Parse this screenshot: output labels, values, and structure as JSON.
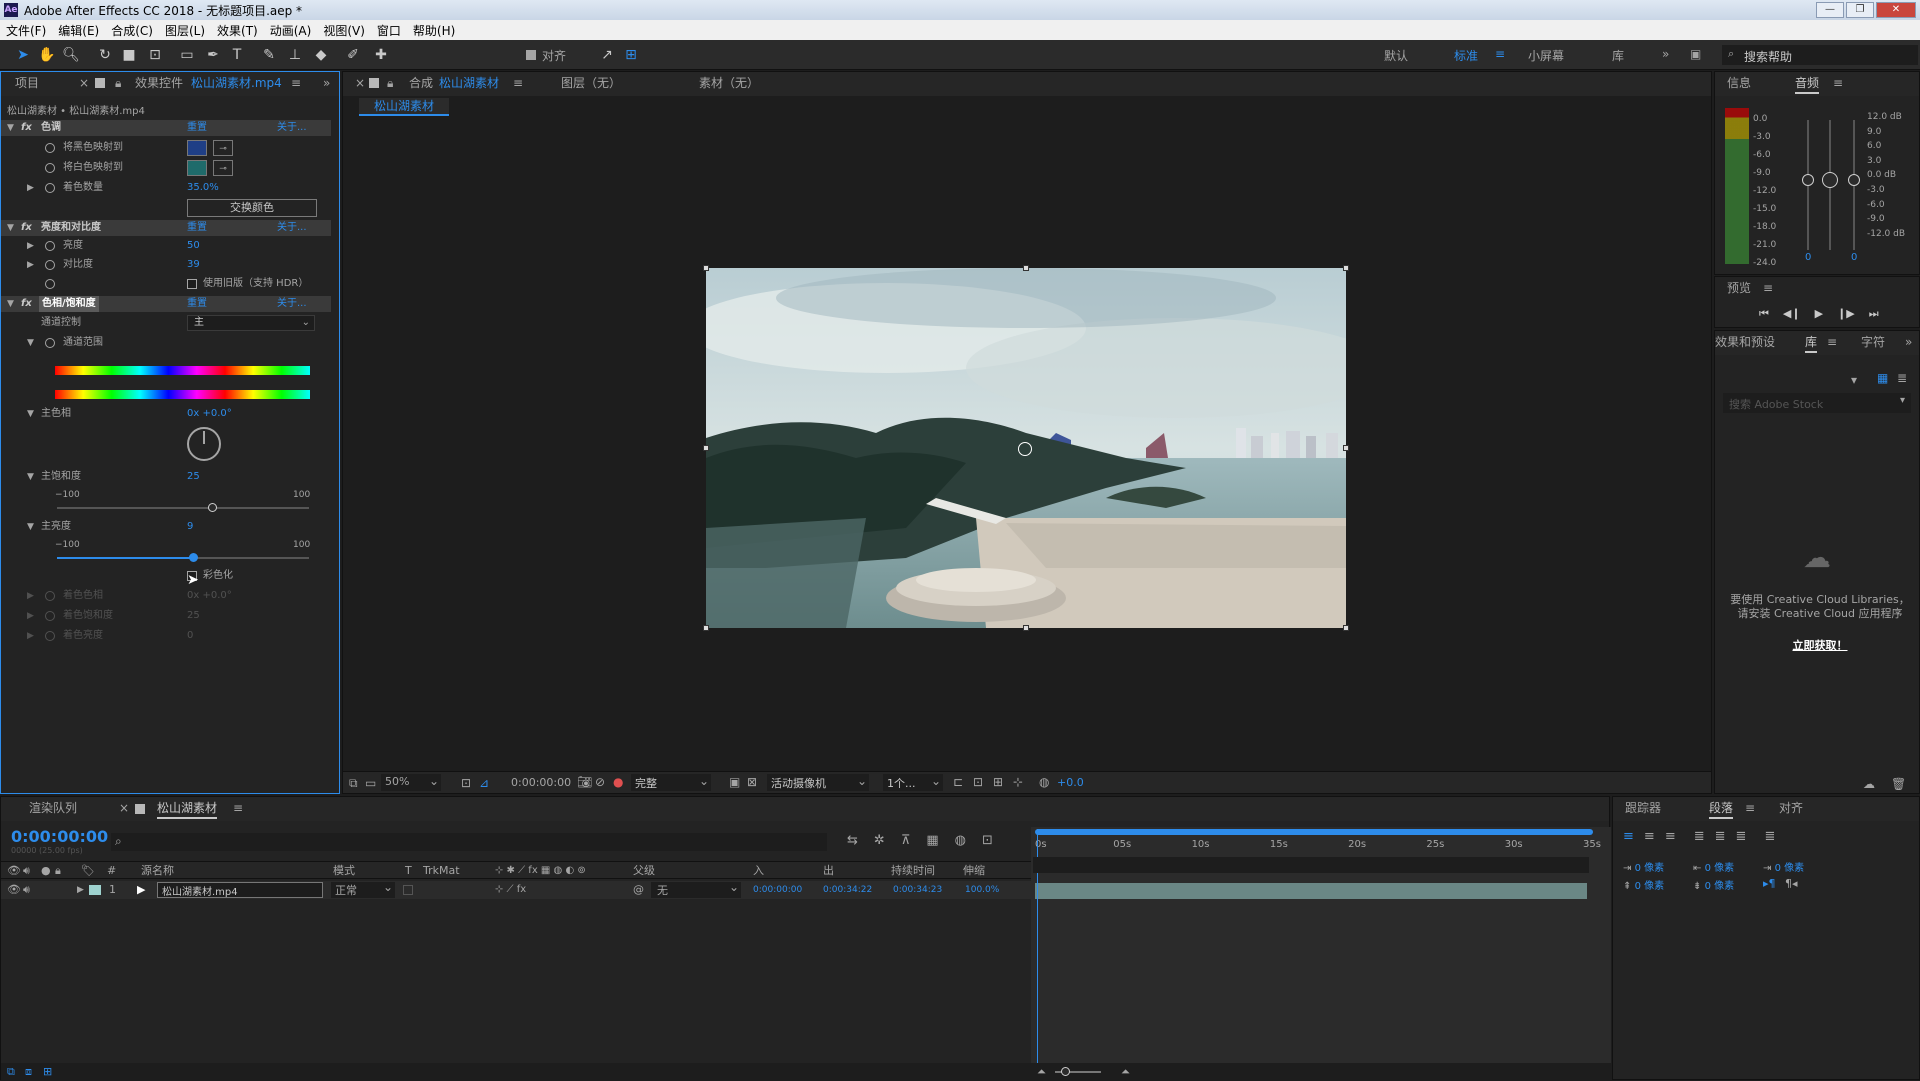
{
  "window": {
    "title": "Adobe After Effects CC 2018 - 无标题项目.aep *"
  },
  "menu": [
    "文件(F)",
    "编辑(E)",
    "合成(C)",
    "图层(L)",
    "效果(T)",
    "动画(A)",
    "视图(V)",
    "窗口",
    "帮助(H)"
  ],
  "toolbar": {
    "align_label": "对齐",
    "ws_default": "默认",
    "ws_standard": "标准",
    "ws_small": "小屏幕",
    "ws_library": "库",
    "search_help": "搜索帮助"
  },
  "left_panel": {
    "tab_project": "项目",
    "tab_effects": "效果控件",
    "tab_effects_file": "松山湖素材.mp4",
    "breadcrumb": "松山湖素材 • 松山湖素材.mp4",
    "tint": {
      "name": "色调",
      "reset": "重置",
      "about": "关于...",
      "map_black": "将黑色映射到",
      "map_white": "将白色映射到",
      "amount_label": "着色数量",
      "amount_val": "35.0%",
      "swap": "交换颜色",
      "black_color": "#1f3f86",
      "white_color": "#1f6b6b"
    },
    "bc": {
      "name": "亮度和对比度",
      "reset": "重置",
      "about": "关于...",
      "brightness_label": "亮度",
      "brightness_val": "50",
      "contrast_label": "对比度",
      "contrast_val": "39",
      "legacy": "使用旧版（支持 HDR）"
    },
    "hs": {
      "name": "色相/饱和度",
      "reset": "重置",
      "about": "关于...",
      "channel_label": "通道控制",
      "channel_val": "主",
      "range_label": "通道范围",
      "hue_label": "主色相",
      "hue_val": "0x +0.0°",
      "sat_label": "主饱和度",
      "sat_val": "25",
      "sat_min": "−100",
      "sat_max": "100",
      "sat_level": 0.62,
      "light_label": "主亮度",
      "light_val": "9",
      "light_min": "−100",
      "light_max": "100",
      "light_level": 0.545,
      "colorize": "彩色化",
      "col_hue": "着色色相",
      "col_hue_val": "0x +0.0°",
      "col_sat": "着色饱和度",
      "col_sat_val": "25",
      "col_light": "着色亮度",
      "col_light_val": "0"
    }
  },
  "comp_panel": {
    "tab_comp": "合成",
    "comp_name": "松山湖素材",
    "tab_layer": "图层（无）",
    "tab_footage": "素材（无）",
    "sub_tab": "松山湖素材"
  },
  "comp_footer": {
    "zoom": "50%",
    "timecode": "0:00:00:00",
    "quality": "完整",
    "camera": "活动摄像机",
    "views": "1个...",
    "exposure": "+0.0"
  },
  "right_panels": {
    "info": "信息",
    "audio": "音频",
    "audio_left": [
      "0.0",
      "-3.0",
      "-6.0",
      "-9.0",
      "-12.0",
      "-15.0",
      "-18.0",
      "-21.0",
      "-24.0"
    ],
    "audio_right": [
      "12.0 dB",
      "9.0",
      "6.0",
      "3.0",
      "0.0 dB",
      "-3.0",
      "-6.0",
      "-9.0",
      "-12.0 dB"
    ],
    "audio_vals": [
      "0",
      "0"
    ],
    "preview": "预览",
    "effects_presets": "效果和预设",
    "library": "库",
    "character": "字符",
    "search_stock": "搜索 Adobe Stock",
    "cc_msg1": "要使用 Creative Cloud Libraries，",
    "cc_msg2": "请安装 Creative Cloud 应用程序",
    "cc_link": "立即获取！",
    "tracker": "跟踪器",
    "paragraph": "段落",
    "align": "对齐",
    "px": "0 像素"
  },
  "timeline": {
    "tab_render": "渲染队列",
    "tab_comp": "松山湖素材",
    "timecode": "0:00:00:00",
    "fps": "00000 (25.00 fps)",
    "cols": {
      "src": "源名称",
      "mode": "模式",
      "t": "T",
      "trkmat": "TrkMat",
      "parent": "父级",
      "in": "入",
      "out": "出",
      "dur": "持续时间",
      "stretch": "伸缩"
    },
    "ruler": [
      "0s",
      "05s",
      "10s",
      "15s",
      "20s",
      "25s",
      "30s",
      "35s"
    ],
    "layer": {
      "num": "1",
      "name": "松山湖素材.mp4",
      "mode": "正常",
      "parent": "无",
      "in": "0:00:00:00",
      "out": "0:00:34:22",
      "dur": "0:00:34:23",
      "stretch": "100.0%"
    }
  }
}
